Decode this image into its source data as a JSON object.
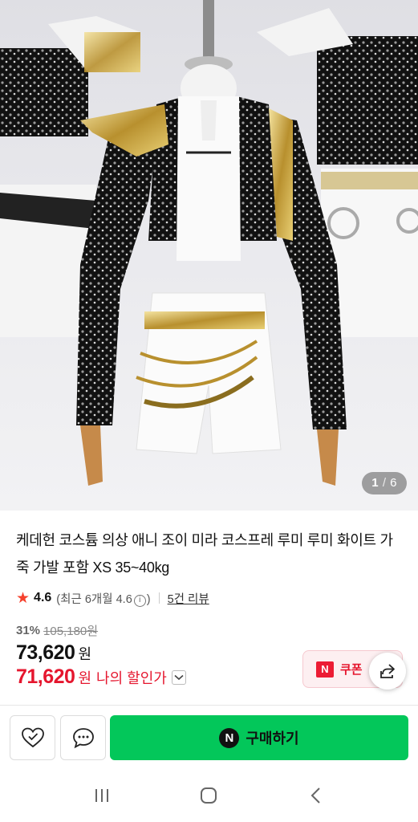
{
  "gallery": {
    "current": "1",
    "separator": "/",
    "total": "6"
  },
  "product": {
    "title": "케데헌 코스튬 의상 애니 조이 미라 코스프레 루미 루미 화이트 가죽 가발 포함 XS 35~40kg",
    "rating": "4.6",
    "recent_rating_prefix": "(최근 6개월 4.6",
    "recent_rating_suffix": ")",
    "review_count_label": "5건 리뷰",
    "discount_rate": "31%",
    "original_price": "105,180원",
    "price": "73,620",
    "price_unit": "원",
    "my_price": "71,620",
    "my_price_unit": "원",
    "my_price_label": "나의 할인가"
  },
  "coupon": {
    "badge": "N",
    "label": "쿠폰"
  },
  "action_bar": {
    "buy_badge": "N",
    "buy_label": "구매하기"
  },
  "icons": {
    "star": "star-icon",
    "info": "info-icon",
    "chevron": "chevron-down-icon",
    "share": "share-icon",
    "wishlist": "heart-check-icon",
    "talk": "chat-bubble-icon",
    "recents": "recents-icon",
    "home": "home-icon",
    "back": "back-icon"
  },
  "colors": {
    "accent_green": "#03c75a",
    "price_red": "#e5162e",
    "star_red": "#f5412d"
  }
}
